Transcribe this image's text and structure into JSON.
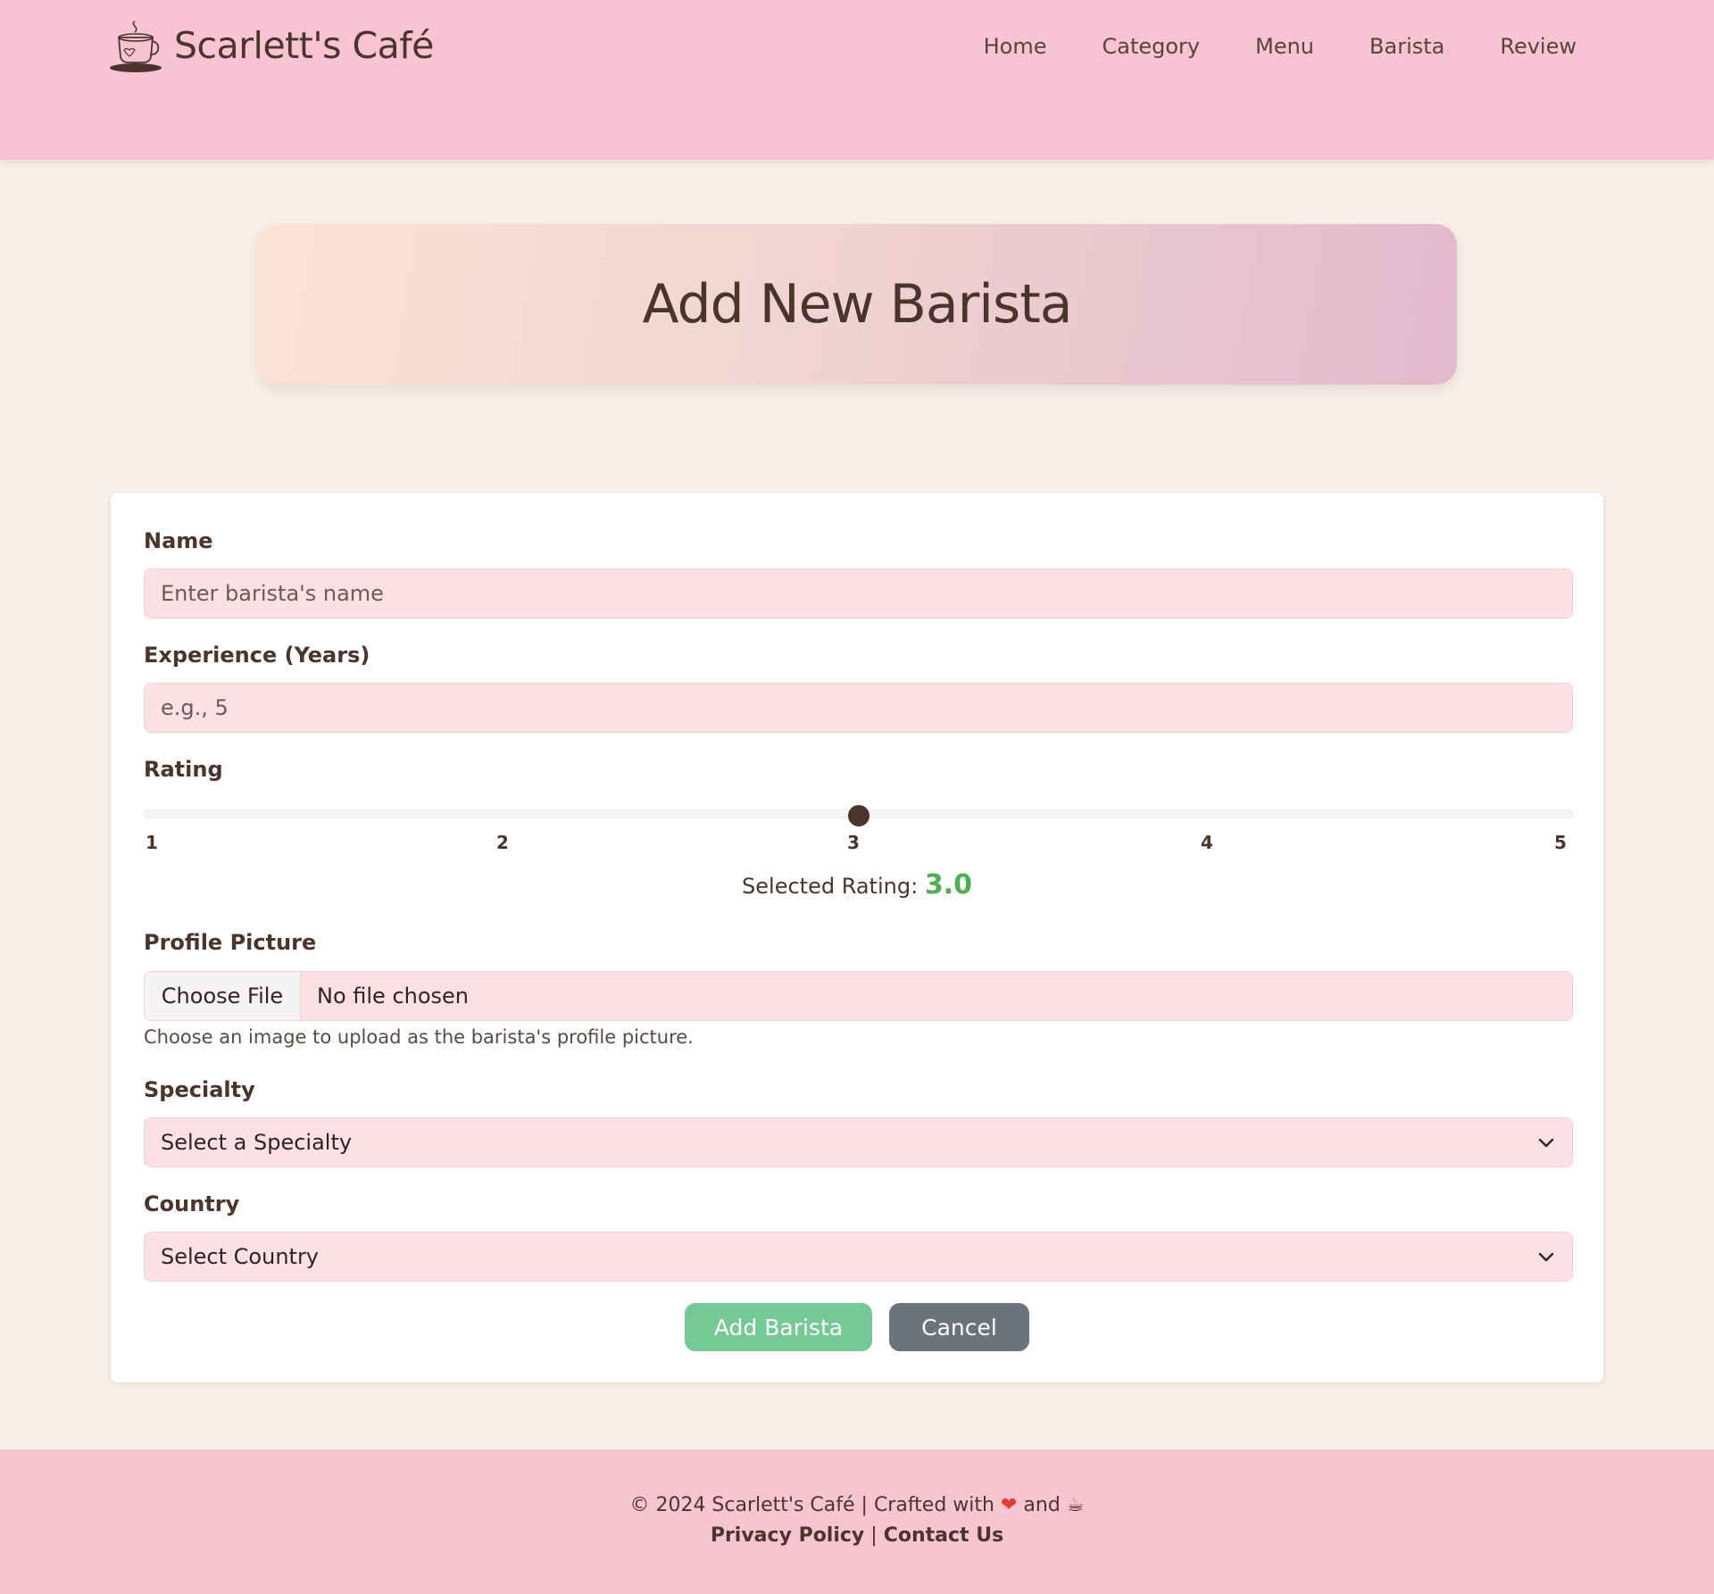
{
  "header": {
    "brand_name": "Scarlett's Café",
    "nav": [
      "Home",
      "Category",
      "Menu",
      "Barista",
      "Review"
    ]
  },
  "banner": {
    "title": "Add New Barista"
  },
  "form": {
    "name_label": "Name",
    "name_placeholder": "Enter barista's name",
    "experience_label": "Experience (Years)",
    "experience_placeholder": "e.g., 5",
    "rating_label": "Rating",
    "rating_ticks": [
      "1",
      "2",
      "3",
      "4",
      "5"
    ],
    "rating_min": 1,
    "rating_max": 5,
    "rating_value": 3,
    "selected_rating_prefix": "Selected Rating:",
    "selected_rating_value": "3.0",
    "profile_label": "Profile Picture",
    "file_button": "Choose File",
    "file_status": "No file chosen",
    "profile_help": "Choose an image to upload as the barista's profile picture.",
    "specialty_label": "Specialty",
    "specialty_value": "Select a Specialty",
    "country_label": "Country",
    "country_value": "Select Country",
    "submit_label": "Add Barista",
    "cancel_label": "Cancel"
  },
  "footer": {
    "copyright_prefix": "© 2024 Scarlett's Café | Crafted with",
    "heart": "❤",
    "and_text": "and",
    "coffee": "☕",
    "privacy": "Privacy Policy",
    "separator": "|",
    "contact": "Contact Us"
  },
  "colors": {
    "header_bg": "#f8c4d3",
    "page_bg": "#f8efe6",
    "input_bg": "#fde0e5",
    "accent_green": "#4caf50",
    "add_button": "#74c995",
    "cancel_button": "#6b737c",
    "text_brown": "#4a342b"
  },
  "icons": {
    "brand": "coffee-cup-icon",
    "select": "chevron-down-icon"
  }
}
